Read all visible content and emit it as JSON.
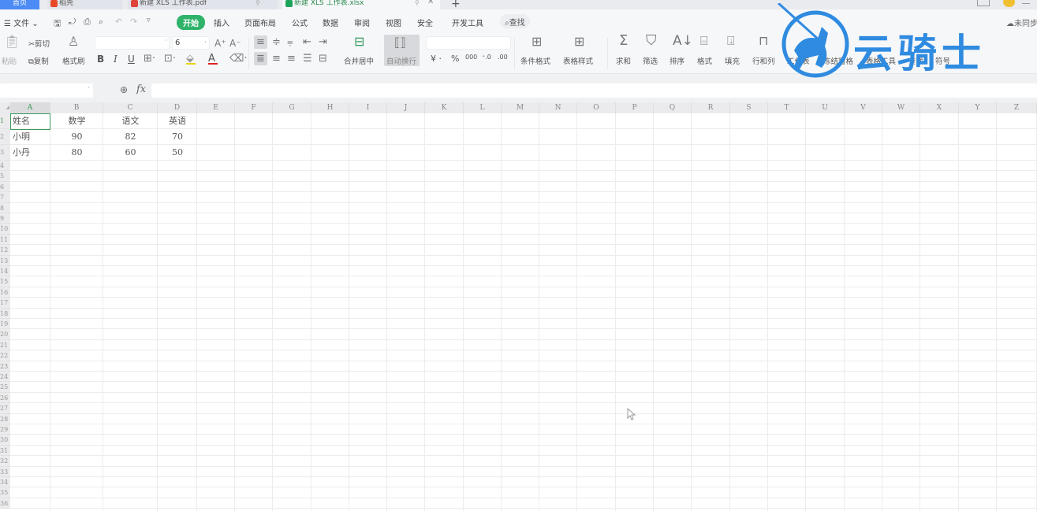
{
  "tabs": [
    {
      "label": "首页",
      "icon": "home"
    },
    {
      "label": "稻壳",
      "icon": "docer-icon"
    },
    {
      "label": "新建 XLS 工作表.pdf",
      "icon": "pdf-icon"
    },
    {
      "label": "新建 XLS 工作表.xlsx",
      "icon": "spreadsheet-icon",
      "active": true
    }
  ],
  "new_tab": "+",
  "menu": {
    "file": "文件",
    "items": [
      "开始",
      "插入",
      "页面布局",
      "公式",
      "数据",
      "审阅",
      "视图",
      "安全",
      "开发工具"
    ],
    "active": "开始",
    "search": "查找",
    "sync": "未同步"
  },
  "ribbon": {
    "paste": "粘贴",
    "cut": "剪切",
    "copy": "复制",
    "format_painter": "格式刷",
    "font_name": "",
    "font_size": "6",
    "bold": "B",
    "italic": "I",
    "underline": "U",
    "merge_center": "合并居中",
    "wrap_text": "自动换行",
    "currency": "¥",
    "percent": "%",
    "thousands": "000",
    "cond_format": "条件格式",
    "table_style": "表格样式",
    "sum": "求和",
    "filter": "筛选",
    "sort": "排序",
    "format": "格式",
    "fill": "填充",
    "row_col": "行和列",
    "worksheet": "工作表",
    "freeze": "冻结窗格",
    "table_tools": "表格工具",
    "find": "查找",
    "symbol": "符号"
  },
  "formula_bar": {
    "name_box": "",
    "fx_label": "fx",
    "content": ""
  },
  "sheet": {
    "columns": [
      "A",
      "B",
      "C",
      "D",
      "E",
      "F",
      "G",
      "H",
      "I",
      "J",
      "K",
      "L",
      "M",
      "N",
      "O",
      "P",
      "Q",
      "R",
      "S",
      "T",
      "U",
      "V",
      "W",
      "X",
      "Y",
      "Z"
    ],
    "selected_cell": "A1",
    "rows": [
      [
        "姓名",
        "数学",
        "语文",
        "英语"
      ],
      [
        "小明",
        "90",
        "82",
        "70"
      ],
      [
        "小丹",
        "80",
        "60",
        "50"
      ]
    ],
    "row_numbers": [
      "1",
      "2",
      "3",
      "4",
      "5",
      "6",
      "7",
      "8",
      "9",
      "10",
      "11",
      "12",
      "13",
      "14",
      "15",
      "16",
      "17",
      "18",
      "19",
      "20",
      "21",
      "22",
      "23",
      "24",
      "25",
      "26",
      "27",
      "28",
      "29",
      "30",
      "31",
      "32",
      "33",
      "34",
      "35",
      "36"
    ]
  },
  "watermark": {
    "text": "云骑士",
    "color": "#2f8be0"
  },
  "colors": {
    "accent": "#2eb369",
    "home_tab": "#4c8bf5",
    "selection": "#3c9a5b"
  }
}
